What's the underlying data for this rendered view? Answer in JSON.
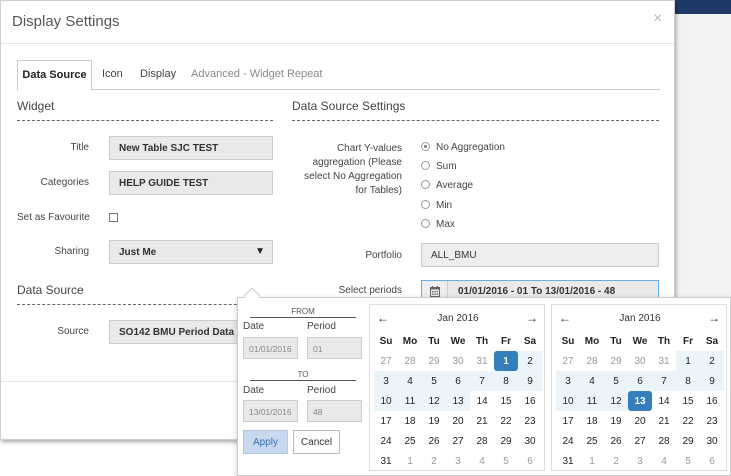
{
  "modal": {
    "title": "Display Settings",
    "close_symbol": "×"
  },
  "tabs": [
    {
      "label": "Data Source",
      "active": true
    },
    {
      "label": "Icon"
    },
    {
      "label": "Display"
    },
    {
      "label": "Advanced - Widget Repeat"
    }
  ],
  "widget": {
    "heading": "Widget",
    "title_label": "Title",
    "title_value": "New Table SJC TEST",
    "categories_label": "Categories",
    "categories_value": "HELP GUIDE TEST",
    "favourite_label": "Set as Favourite",
    "sharing_label": "Sharing",
    "sharing_value": "Just Me"
  },
  "data_source": {
    "heading": "Data Source",
    "source_label": "Source",
    "source_value": "SO142 BMU Period Data"
  },
  "settings": {
    "heading": "Data Source Settings",
    "aggregation_label_lines": [
      "Chart Y-values",
      "aggregation (Please",
      "select No Aggregation",
      "for Tables)"
    ],
    "aggregation_options": [
      "No Aggregation",
      "Sum",
      "Average",
      "Min",
      "Max"
    ],
    "aggregation_selected": "No Aggregation",
    "portfolio_label": "Portfolio",
    "portfolio_value": "ALL_BMU",
    "periods_label": "Select periods",
    "periods_value": "01/01/2016 - 01 To 13/01/2016 - 48"
  },
  "picker": {
    "from_heading": "FROM",
    "to_heading": "TO",
    "date_label": "Date",
    "period_label": "Period",
    "from_date": "01/01/2016",
    "from_period": "01",
    "to_date": "13/01/2016",
    "to_period": "48",
    "apply_label": "Apply",
    "cancel_label": "Cancel",
    "prev_symbol": "🡐",
    "next_symbol": "🡒",
    "days_of_week": [
      "Su",
      "Mo",
      "Tu",
      "We",
      "Th",
      "Fr",
      "Sa"
    ],
    "calendars": [
      {
        "month": "Jan 2016",
        "weeks": [
          [
            "27",
            "28",
            "29",
            "30",
            "31",
            "1",
            "2"
          ],
          [
            "3",
            "4",
            "5",
            "6",
            "7",
            "8",
            "9"
          ],
          [
            "10",
            "11",
            "12",
            "13",
            "14",
            "15",
            "16"
          ],
          [
            "17",
            "18",
            "19",
            "20",
            "21",
            "22",
            "23"
          ],
          [
            "24",
            "25",
            "26",
            "27",
            "28",
            "29",
            "30"
          ],
          [
            "31",
            "1",
            "2",
            "3",
            "4",
            "5",
            "6"
          ]
        ]
      },
      {
        "month": "Jan 2016",
        "weeks": [
          [
            "27",
            "28",
            "29",
            "30",
            "31",
            "1",
            "2"
          ],
          [
            "3",
            "4",
            "5",
            "6",
            "7",
            "8",
            "9"
          ],
          [
            "10",
            "11",
            "12",
            "13",
            "14",
            "15",
            "16"
          ],
          [
            "17",
            "18",
            "19",
            "20",
            "21",
            "22",
            "23"
          ],
          [
            "24",
            "25",
            "26",
            "27",
            "28",
            "29",
            "30"
          ],
          [
            "31",
            "1",
            "2",
            "3",
            "4",
            "5",
            "6"
          ]
        ]
      }
    ]
  }
}
